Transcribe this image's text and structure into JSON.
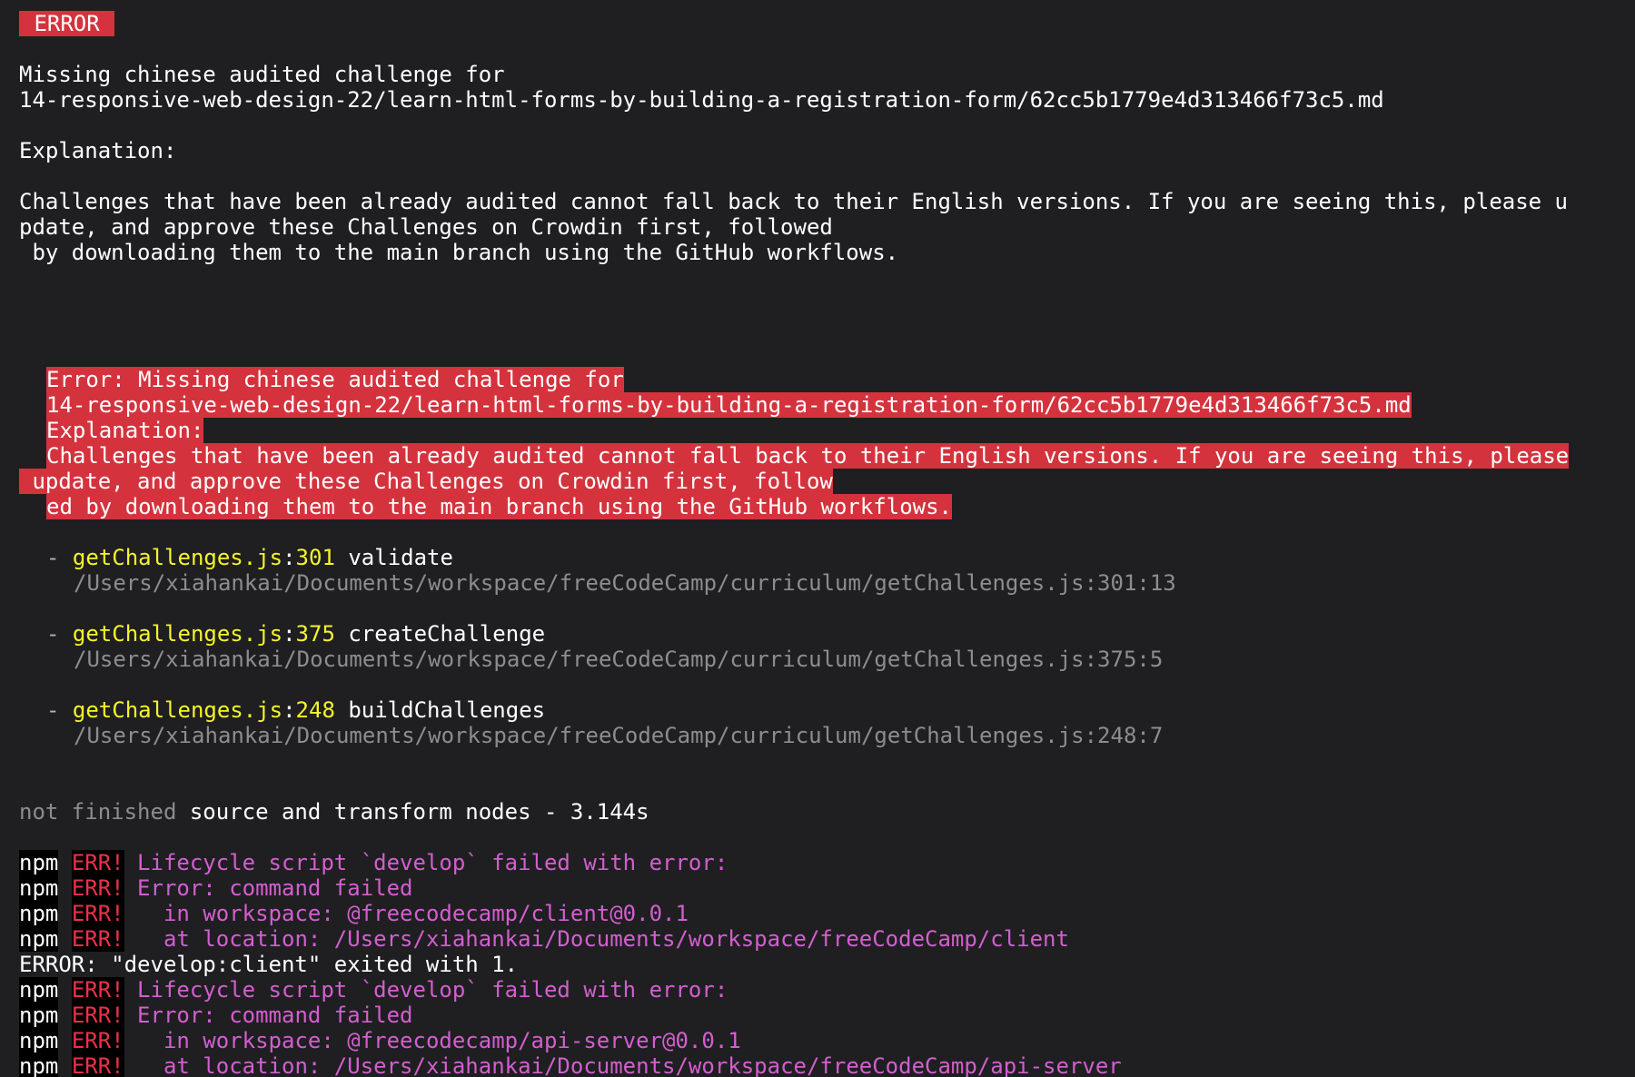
{
  "terminal": {
    "error_badge": " ERROR ",
    "missing_line_1": "Missing chinese audited challenge for",
    "missing_line_2": "14-responsive-web-design-22/learn-html-forms-by-building-a-registration-form/62cc5b1779e4d313466f73c5.md",
    "explanation_label": "Explanation:",
    "explanation_line_1": "Challenges that have been already audited cannot fall back to their English versions. If you are seeing this, please u",
    "explanation_line_2": "pdate, and approve these Challenges on Crowdin first, followed",
    "explanation_line_3": " by downloading them to the main branch using the GitHub workflows.",
    "highlight_block": {
      "line_1": "Error: Missing chinese audited challenge for",
      "line_2": "14-responsive-web-design-22/learn-html-forms-by-building-a-registration-form/62cc5b1779e4d313466f73c5.md",
      "line_3": "Explanation:",
      "line_4": "Challenges that have been already audited cannot fall back to their English versions. If you are seeing this, please",
      "line_5": " update, and approve these Challenges on Crowdin first, follow",
      "line_6": "ed by downloading them to the main branch using the GitHub workflows."
    },
    "stack": [
      {
        "bullet": "-",
        "file": "getChallenges.js",
        "sep": ":",
        "line": "301",
        "func": "validate",
        "path": "/Users/xiahankai/Documents/workspace/freeCodeCamp/curriculum/getChallenges.js:301:13"
      },
      {
        "bullet": "-",
        "file": "getChallenges.js",
        "sep": ":",
        "line": "375",
        "func": "createChallenge",
        "path": "/Users/xiahankai/Documents/workspace/freeCodeCamp/curriculum/getChallenges.js:375:5"
      },
      {
        "bullet": "-",
        "file": "getChallenges.js",
        "sep": ":",
        "line": "248",
        "func": "buildChallenges",
        "path": "/Users/xiahankai/Documents/workspace/freeCodeCamp/curriculum/getChallenges.js:248:7"
      }
    ],
    "status_prefix": "not finished",
    "status_text": " source and transform nodes - 3.144s",
    "npm_tag": "npm",
    "err_tag": "ERR!",
    "npm_lines": [
      {
        "message": " Lifecycle script `develop` failed with error:"
      },
      {
        "message": " Error: command failed"
      },
      {
        "message": "   in workspace: @freecodecamp/client@0.0.1"
      },
      {
        "message": "   at location: /Users/xiahankai/Documents/workspace/freeCodeCamp/client"
      }
    ],
    "exit_line": "ERROR: \"develop:client\" exited with 1.",
    "npm_lines_2": [
      {
        "message": " Lifecycle script `develop` failed with error:"
      },
      {
        "message": " Error: command failed"
      },
      {
        "message": "   in workspace: @freecodecamp/api-server@0.0.1"
      },
      {
        "message": "   at location: /Users/xiahankai/Documents/workspace/freeCodeCamp/api-server"
      }
    ]
  },
  "colors": {
    "background": "#1f1f21",
    "error_red": "#d4333d",
    "yellow": "#f5f52a",
    "magenta": "#d45ed0",
    "dim": "#8d8d8d"
  }
}
